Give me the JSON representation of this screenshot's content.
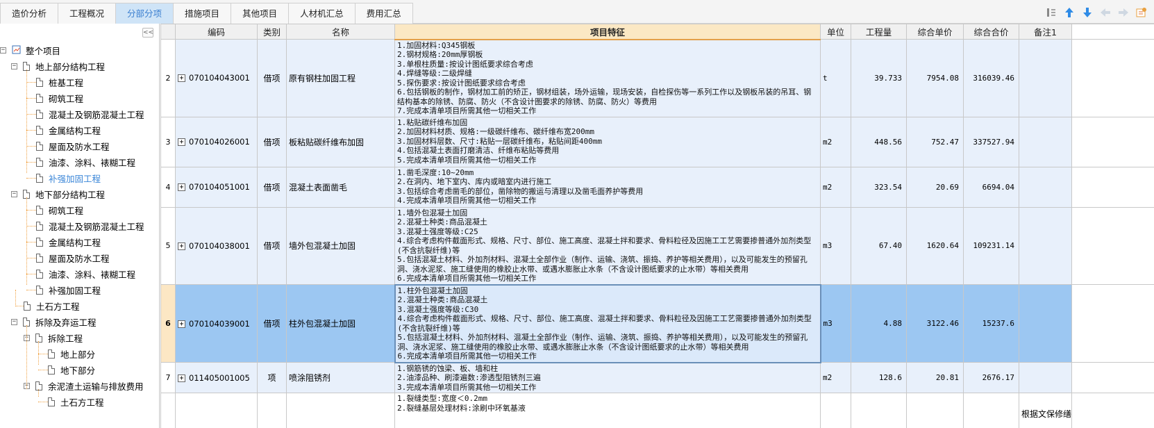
{
  "tabs": [
    "造价分析",
    "工程概况",
    "分部分项",
    "措施项目",
    "其他项目",
    "人材机汇总",
    "费用汇总"
  ],
  "active_tab": "分部分项",
  "toolbar_icons": [
    "reorder-icon",
    "move-up-icon",
    "move-down-icon",
    "move-left-icon",
    "move-right-icon",
    "settings-icon"
  ],
  "tree": {
    "collapse_label": "<<",
    "root": "整个项目",
    "above": "地上部分结构工程",
    "above_items": [
      "桩基工程",
      "砌筑工程",
      "混凝土及钢筋混凝土工程",
      "金属结构工程",
      "屋面及防水工程",
      "油漆、涂料、裱糊工程",
      "补强加固工程"
    ],
    "below": "地下部分结构工程",
    "below_items": [
      "砌筑工程",
      "混凝土及钢筋混凝土工程",
      "金属结构工程",
      "屋面及防水工程",
      "油漆、涂料、裱糊工程",
      "补强加固工程"
    ],
    "earth": "土石方工程",
    "demo": "拆除及弃运工程",
    "demo_sub": "拆除工程",
    "demo_sub_items": [
      "地上部分",
      "地下部分"
    ],
    "muck": "余泥渣土运输与排放费用",
    "muck_items": [
      "土石方工程"
    ]
  },
  "columns": {
    "code": "编码",
    "type": "类别",
    "name": "名称",
    "feature": "项目特征",
    "unit": "单位",
    "qty": "工程量",
    "price": "综合单价",
    "total": "综合合价",
    "remark": "备注1"
  },
  "rows": [
    {
      "no": "2",
      "code": "070104043001",
      "type": "借项",
      "name": "原有钢柱加固工程",
      "feature": [
        "1.加固材料:Q345钢板",
        "2.钢材规格:20mm厚钢板",
        "3.单根柱质量:按设计图纸要求综合考虑",
        "4.焊缝等级:二级焊缝",
        "5.探伤要求:按设计图纸要求综合考虑",
        "6.包括钢板的制作，钢材加工前的矫正，钢材组装，场外运输，现场安装，自检探伤等一系列工作以及钢板吊装的吊耳、钢结构基本的除锈、防腐、防火（不含设计图要求的除锈、防腐、防火）等费用",
        "7.完成本清单项目所需其他一切相关工作"
      ],
      "unit": "t",
      "qty": "39.733",
      "price": "7954.08",
      "total": "316039.46",
      "remark": ""
    },
    {
      "no": "3",
      "code": "070104026001",
      "type": "借项",
      "name": "板粘贴碳纤维布加固",
      "feature": [
        "1.粘贴碳纤维布加固",
        "2.加固材料材质、规格:一级碳纤维布、碳纤维布宽200mm",
        "3.加固材料层数、尺寸:粘贴一层碳纤维布，粘贴间距400mm",
        "4.包括混凝土表面打磨清洁、纤维布粘贴等费用",
        "5.完成本清单项目所需其他一切相关工作"
      ],
      "unit": "m2",
      "qty": "448.56",
      "price": "752.47",
      "total": "337527.94",
      "remark": ""
    },
    {
      "no": "4",
      "code": "070104051001",
      "type": "借项",
      "name": "混凝土表面凿毛",
      "feature": [
        "1.凿毛深度:10~20mm",
        "2.在洞内、地下室内、库内或暗室内进行施工",
        "3.包括综合考虑凿毛的部位，凿除物的搬运与清理以及凿毛面养护等费用",
        "4.完成本清单项目所需其他一切相关工作"
      ],
      "unit": "m2",
      "qty": "323.54",
      "price": "20.69",
      "total": "6694.04",
      "remark": ""
    },
    {
      "no": "5",
      "code": "070104038001",
      "type": "借项",
      "name": "墙外包混凝土加固",
      "feature": [
        "1.墙外包混凝土加固",
        "2.混凝土种类:商品混凝土",
        "3.混凝土强度等级:C25",
        "4.综合考虑构件截面形式、规格、尺寸、部位、施工高度、混凝土拌和要求、骨料粒径及因施工工艺需要掺普通外加剂类型(不含抗裂纤维)等",
        "5.包括混凝土材料、外加剂材料、混凝土全部作业（制作、运输、浇筑、振捣、养护等相关费用），以及可能发生的预留孔洞、浇水泥浆、施工缝使用的橡胶止水带、或遇水膨胀止水条（不含设计图纸要求的止水带）等相关费用",
        "6.完成本清单项目所需其他一切相关工作"
      ],
      "unit": "m3",
      "qty": "67.40",
      "price": "1620.64",
      "total": "109231.14",
      "remark": ""
    },
    {
      "no": "6",
      "code": "070104039001",
      "type": "借项",
      "name": "柱外包混凝土加固",
      "feature": [
        "1.柱外包混凝土加固",
        "2.混凝土种类:商品混凝土",
        "3.混凝土强度等级:C30",
        "4.综合考虑构件截面形式、规格、尺寸、部位、施工高度、混凝土拌和要求、骨料粒径及因施工工艺需要掺普通外加剂类型(不含抗裂纤维)等",
        "5.包括混凝土材料、外加剂材料、混凝土全部作业（制作、运输、浇筑、振捣、养护等相关费用），以及可能发生的预留孔洞、浇水泥浆、施工缝使用的橡胶止水带、或遇水膨胀止水条（不含设计图纸要求的止水带）等相关费用",
        "6.完成本清单项目所需其他一切相关工作"
      ],
      "unit": "m3",
      "qty": "4.88",
      "price": "3122.46",
      "total": "15237.6",
      "remark": ""
    },
    {
      "no": "7",
      "code": "011405001005",
      "type": "项",
      "name": "喷涂阻锈剂",
      "feature": [
        "1.钢筋锈的蚀梁、板、墙和柱",
        "2.油漆品种、刷漆遍数:渗透型阻锈剂三遍",
        "3.完成本清单项目所需其他一切相关工作"
      ],
      "unit": "m2",
      "qty": "128.6",
      "price": "20.81",
      "total": "2676.17",
      "remark": ""
    },
    {
      "no": "",
      "code": "",
      "type": "",
      "name": "",
      "feature": [
        "1.裂缝类型:宽度＜0.2mm",
        "2.裂缝基层处理材料:涂刷中环氧基液"
      ],
      "unit": "",
      "qty": "",
      "price": "",
      "total": "",
      "remark": "根据文保修缮"
    }
  ],
  "selected_row": "6"
}
